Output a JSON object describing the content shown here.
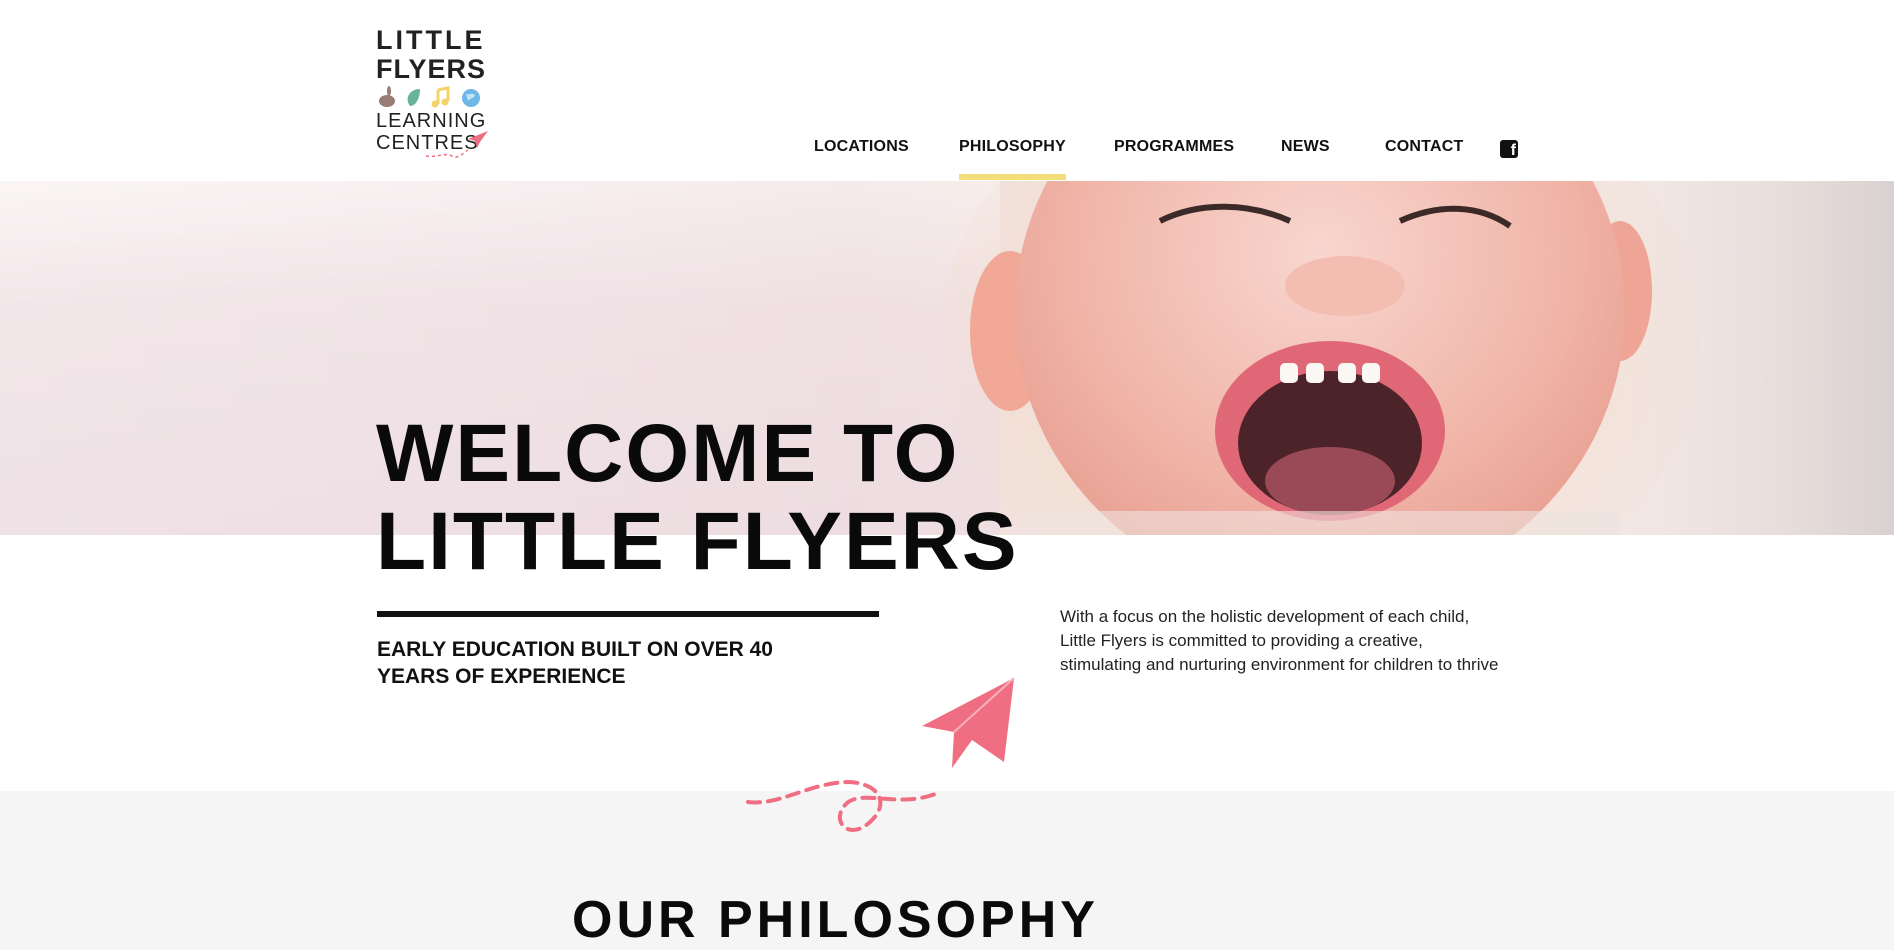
{
  "logo": {
    "line1": "LITTLE",
    "line2": "FLYERS",
    "line3": "LEARNING",
    "line4": "CENTRES",
    "icons": [
      "rabbit-icon",
      "leaf-icon",
      "music-note-icon",
      "globe-icon"
    ]
  },
  "nav": {
    "items": [
      {
        "label": "LOCATIONS"
      },
      {
        "label": "PHILOSOPHY",
        "active": true
      },
      {
        "label": "PROGRAMMES"
      },
      {
        "label": "NEWS"
      },
      {
        "label": "CONTACT"
      }
    ],
    "social": "facebook-icon"
  },
  "hero": {
    "heading_line1": "WELCOME TO",
    "heading_line2": "LITTLE FLYERS",
    "tagline": "EARLY EDUCATION BUILT ON OVER 40 YEARS OF EXPERIENCE",
    "intro": "With a focus on the holistic development of each child, Little Flyers is committed to providing a creative, stimulating and nurturing environment for children to thrive"
  },
  "section": {
    "title": "OUR PHILOSOPHY"
  },
  "colors": {
    "accent_pink": "#f06e82",
    "nav_underline": "#f3de7a",
    "text": "#111111",
    "section_bg": "#f5f5f5"
  }
}
